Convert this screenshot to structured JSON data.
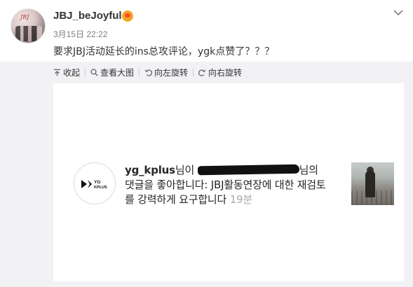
{
  "post": {
    "username": "JBJ_beJoyful",
    "timestamp": "3月15日 22:22",
    "text": "要求JBJ活动延长的ins总攻评论，ygk点赞了？？？",
    "avatar_text": "JBJ"
  },
  "toolbar": {
    "collapse_label": "收起",
    "view_large_label": "查看大图",
    "rotate_left_label": "向左旋转",
    "rotate_right_label": "向右旋转"
  },
  "notification": {
    "username": "yg_kplus",
    "text_after_user": "님이 ",
    "text_after_redaction": "님의 댓글을 좋아합니다: JBJ활동연장에 대한 재검토를 강력하게 요구합니다",
    "time_ago": "19분",
    "logo_text_line1": "YG",
    "logo_text_line2": "KPLUS"
  },
  "colors": {
    "panel_bg": "#f2f2f5",
    "text_main": "#333333",
    "text_muted": "#808080",
    "ig_time": "#aaaaaa",
    "badge": "#f4a623"
  },
  "icons": {
    "collapse": "collapse-arrow-icon",
    "view_large": "magnifier-icon",
    "rotate_left": "rotate-left-icon",
    "rotate_right": "rotate-right-icon",
    "menu": "chevron-down-icon",
    "badge": "member-badge-icon"
  }
}
